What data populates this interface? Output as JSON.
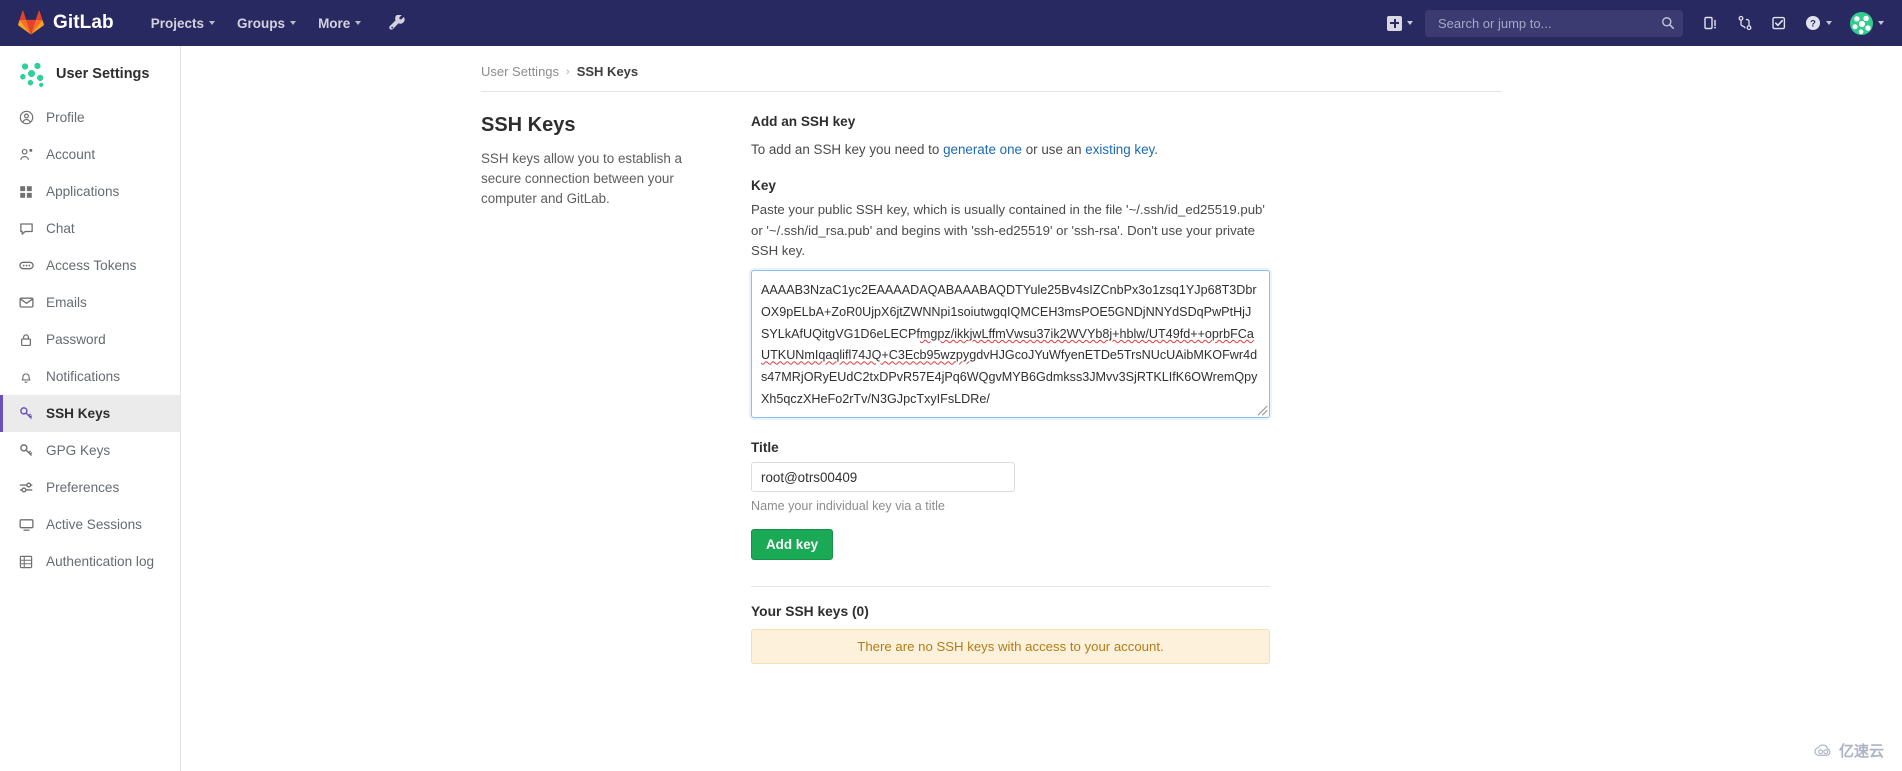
{
  "navbar": {
    "brand": "GitLab",
    "brand_icon": "gitlab-tanuki-logo",
    "links": [
      {
        "label": "Projects",
        "icon": "chevron-down-icon"
      },
      {
        "label": "Groups",
        "icon": "chevron-down-icon"
      },
      {
        "label": "More",
        "icon": "chevron-down-icon"
      }
    ],
    "admin_icon": "wrench-icon",
    "new_icon": "plus-square-icon",
    "new_caret_icon": "chevron-down-icon",
    "search": {
      "placeholder": "Search or jump to...",
      "value": "",
      "icon": "search-icon"
    },
    "icons": [
      {
        "name": "issues-icon"
      },
      {
        "name": "merge-requests-icon"
      },
      {
        "name": "todos-icon"
      },
      {
        "name": "help-question-icon"
      }
    ],
    "avatar_icon": "user-avatar",
    "bg_color": "#292961"
  },
  "sidebar": {
    "title": "User Settings",
    "avatar_icon": "user-avatar-identicon",
    "items": [
      {
        "label": "Profile",
        "icon": "user-circle-icon",
        "active": false
      },
      {
        "label": "Account",
        "icon": "account-gear-icon",
        "active": false
      },
      {
        "label": "Applications",
        "icon": "applications-grid-icon",
        "active": false
      },
      {
        "label": "Chat",
        "icon": "chat-bubble-icon",
        "active": false
      },
      {
        "label": "Access Tokens",
        "icon": "token-icon",
        "active": false
      },
      {
        "label": "Emails",
        "icon": "envelope-icon",
        "active": false
      },
      {
        "label": "Password",
        "icon": "lock-icon",
        "active": false
      },
      {
        "label": "Notifications",
        "icon": "bell-icon",
        "active": false
      },
      {
        "label": "SSH Keys",
        "icon": "key-icon",
        "active": true
      },
      {
        "label": "GPG Keys",
        "icon": "key-icon",
        "active": false
      },
      {
        "label": "Preferences",
        "icon": "sliders-icon",
        "active": false
      },
      {
        "label": "Active Sessions",
        "icon": "monitor-icon",
        "active": false
      },
      {
        "label": "Authentication log",
        "icon": "log-table-icon",
        "active": false
      }
    ],
    "accent_color": "#6b4fbb"
  },
  "breadcrumb": {
    "root": "User Settings",
    "separator": "›",
    "current": "SSH Keys"
  },
  "page": {
    "heading": "SSH Keys",
    "description": "SSH keys allow you to establish a secure connection between your computer and GitLab."
  },
  "form": {
    "section_title": "Add an SSH key",
    "intro_prefix": "To add an SSH key you need to ",
    "intro_link1": "generate one",
    "intro_middle": " or use an ",
    "intro_link2": "existing key",
    "intro_suffix": ".",
    "key_label": "Key",
    "key_help": "Paste your public SSH key, which is usually contained in the file '~/.ssh/id_ed25519.pub' or '~/.ssh/id_rsa.pub' and begins with 'ssh-ed25519' or 'ssh-rsa'. Don't use your private SSH key.",
    "key_value_lines": [
      "AAAAB3NzaC1yc2EAAAADAQABAAABAQDTYule25Bv4sIZCnbPx3o1zsq1YJp68T3DbrOX9pELbA+Z",
      "oR0UjpX6jtZWNNpi1soiutwgqIQMCEH3msPOE5GNDjNNYdSDqPwPtHjJSYLkAfUQitgVG1D6eLECPf",
      "mgpz/ikkjwLffmVwsu37ik2WVYb8j+hblw/UT49fd++oprbFCaUTKUNmIqaqlifl74JQ+C3Ecb95wzpy",
      "gdvHJGcoJYuWfyenETDe5TrsNUcUAibMKOFwr4ds47MRjORyEUdC2txDPvR57E4jPq6WQgvMYB6G",
      "dmkss3JMvv3SjRTKLIfK6OWremQpyXh5qczXHeFo2rTv/N3GJpcTxyIFsLDRe/"
    ],
    "key_value": "AAAAB3NzaC1yc2EAAAADAQABAAABAQDTYule25Bv4sIZCnbPx3o1zsq1YJp68T3DbrOX9pELbA+ZoR0UjpX6jtZWNNpi1soiutwgqIQMCEH3msPOE5GNDjNNYdSDqPwPtHjJSYLkAfUQitgVG1D6eLECPfmgpz/ikkjwLffmVwsu37ik2WVYb8j+hblw/UT49fd++oprbFCaUTKUNmIqaqlifl74JQ+C3Ecb95wzpygdvHJGcoJYuWfyenETDe5TrsNUcUAibMKOFwr4ds47MRjORyEUdC2txDPvR57E4jPq6WQgvMYB6Gdmkss3JMvv3SjRTKLIfK6OWremQpyXh5qczXHeFo2rTv/N3GJpcTxyIFsLDRe/",
    "key_placeholder": "",
    "title_label": "Title",
    "title_value": "root@otrs00409",
    "title_placeholder": "",
    "title_hint": "Name your individual key via a title",
    "submit_label": "Add key",
    "submit_color": "#1aaa55"
  },
  "keys_list": {
    "heading": "Your SSH keys (0)",
    "empty_message": "There are no SSH keys with access to your account.",
    "empty_bg": "#fdf1dc",
    "empty_color": "#b07d18"
  },
  "watermark": {
    "text": "亿速云",
    "icon": "cloud-icon"
  }
}
